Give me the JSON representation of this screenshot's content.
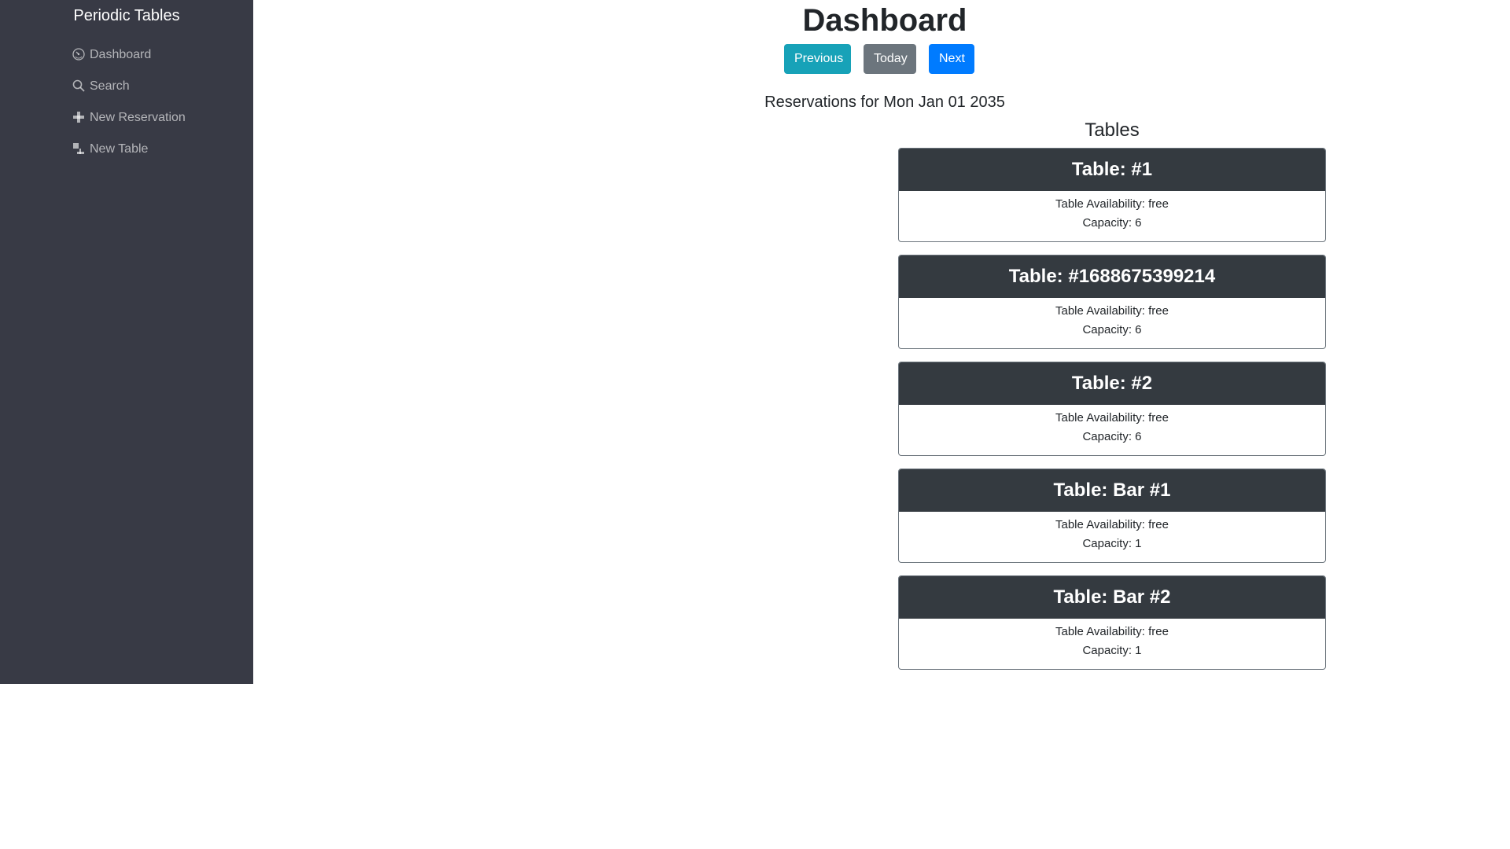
{
  "sidebar": {
    "brand": "Periodic Tables",
    "items": [
      {
        "label": "Dashboard",
        "icon": "dashboard-icon"
      },
      {
        "label": "Search",
        "icon": "search-icon"
      },
      {
        "label": "New Reservation",
        "icon": "plus-icon"
      },
      {
        "label": "New Table",
        "icon": "table-icon"
      }
    ]
  },
  "main": {
    "title": "Dashboard",
    "buttons": {
      "previous": "Previous",
      "today": "Today",
      "next": "Next"
    },
    "reservations_heading": "Reservations for Mon Jan 01 2035",
    "tables_heading": "Tables",
    "tables": [
      {
        "name": "Table: #1",
        "availability": "Table Availability: free",
        "capacity": "Capacity: 6"
      },
      {
        "name": "Table: #1688675399214",
        "availability": "Table Availability: free",
        "capacity": "Capacity: 6"
      },
      {
        "name": "Table: #2",
        "availability": "Table Availability: free",
        "capacity": "Capacity: 6"
      },
      {
        "name": "Table: Bar #1",
        "availability": "Table Availability: free",
        "capacity": "Capacity: 1"
      },
      {
        "name": "Table: Bar #2",
        "availability": "Table Availability: free",
        "capacity": "Capacity: 1"
      }
    ]
  },
  "colors": {
    "sidebar_bg": "#383a45",
    "card_header_bg": "#343a40",
    "previous_button": "#17a2b8",
    "today_button": "#6c757d",
    "next_button": "#007bff"
  }
}
